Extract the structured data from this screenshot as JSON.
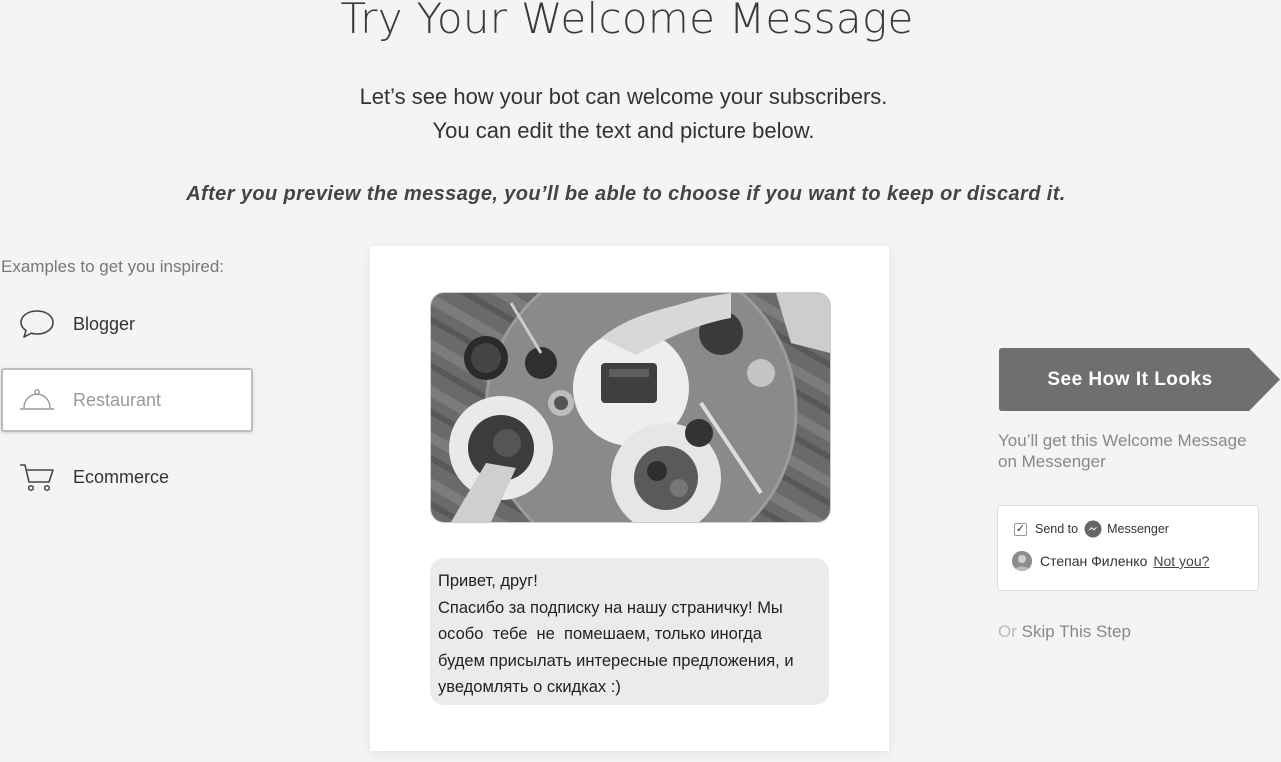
{
  "header": {
    "title": "Try Your Welcome Message",
    "intro_line1": "Let’s see how your bot can welcome your subscribers.",
    "intro_line2": "You can edit the text and picture below.",
    "note": "After you preview the message, you’ll be able to choose if you want to keep or discard it."
  },
  "examples": {
    "label": "Examples to get you inspired:",
    "items": [
      {
        "label": "Blogger",
        "icon": "speech-bubble-icon",
        "selected": false
      },
      {
        "label": "Restaurant",
        "icon": "cloche-icon",
        "selected": true
      },
      {
        "label": "Ecommerce",
        "icon": "shopping-cart-icon",
        "selected": false
      }
    ]
  },
  "preview": {
    "image": "overhead photo of a table with breakfast dishes",
    "message_lines": [
      "Привет, друг!",
      "Спасибо за подписку на нашу страничку! Мы",
      "особо  тебе  не  помешаем, только иногда",
      "будем присылать интересные предложения, и",
      "уведомлять о скидках :)"
    ]
  },
  "cta": {
    "label": "See How It Looks",
    "note_line1": "You’ll get this Welcome Message",
    "note_line2": "on Messenger",
    "color": "#6f6f6f"
  },
  "plugin": {
    "checked": true,
    "send_to": "Send to",
    "messenger": "Messenger",
    "user_name": "Степан Филенко",
    "not_you": "Not you?"
  },
  "skip": {
    "or": "Or",
    "label": "Skip This Step"
  }
}
